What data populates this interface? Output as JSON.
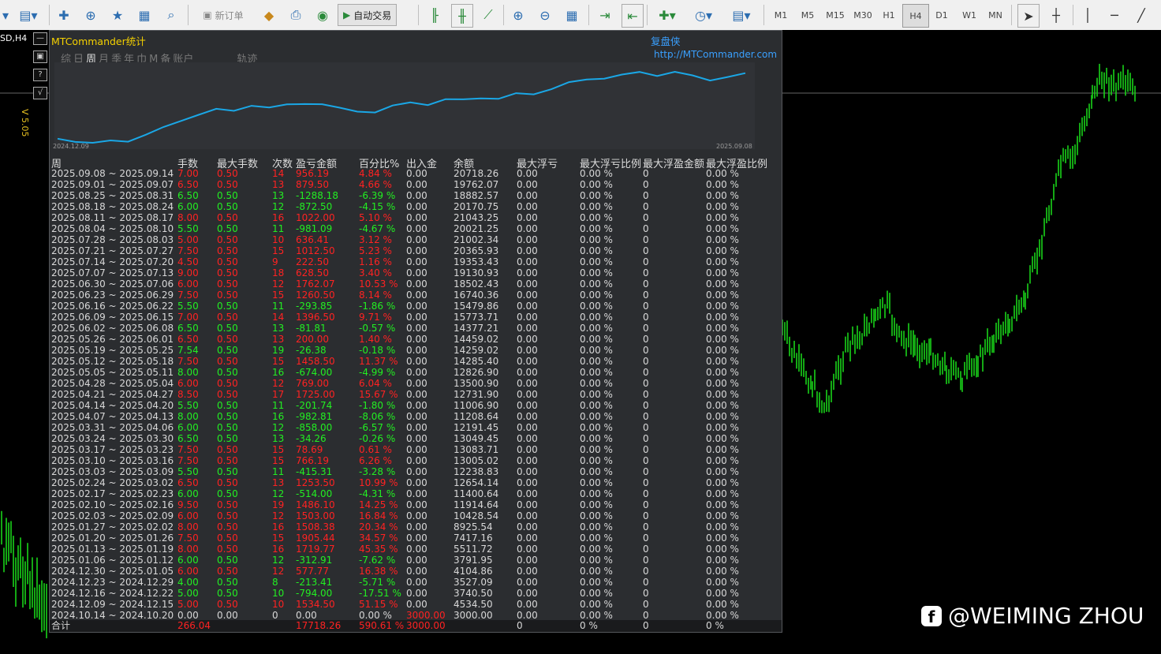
{
  "toolbar": {
    "new_order": "新订单",
    "auto_trade": "自动交易",
    "timeframes": [
      "M1",
      "M5",
      "M15",
      "M30",
      "H1",
      "H4",
      "D1",
      "W1",
      "MN"
    ],
    "selected_tf": "H4"
  },
  "chart": {
    "symbol_label": "SD,H4",
    "version": "V 5.05",
    "watermark": "@WEIMING ZHOU"
  },
  "panel": {
    "title": "MTCommander统计",
    "brand": "复盘侠",
    "url": "http://MTCommander.com",
    "tabs": [
      "综",
      "日",
      "周",
      "月",
      "季",
      "年",
      "巾",
      "M",
      "备",
      "账户",
      "轨迹"
    ],
    "active_tab": "周",
    "eq_start": "2024.12.09",
    "eq_end": "2025.09.08",
    "headers": [
      "周",
      "手数",
      "最大手数",
      "次数",
      "盈亏金额",
      "百分比%",
      "出入金",
      "余额",
      "最大浮亏",
      "最大浮亏比例",
      "最大浮盈金额",
      "最大浮盈比例"
    ],
    "rows": [
      [
        "2025.09.08 ~ 2025.09.14",
        "7.00",
        "0.50",
        "14",
        "956.19",
        "4.84 %",
        "0.00",
        "20718.26",
        "0.00",
        "0.00 %",
        "0",
        "0.00 %"
      ],
      [
        "2025.09.01 ~ 2025.09.07",
        "6.50",
        "0.50",
        "13",
        "879.50",
        "4.66 %",
        "0.00",
        "19762.07",
        "0.00",
        "0.00 %",
        "0",
        "0.00 %"
      ],
      [
        "2025.08.25 ~ 2025.08.31",
        "6.50",
        "0.50",
        "13",
        "-1288.18",
        "-6.39 %",
        "0.00",
        "18882.57",
        "0.00",
        "0.00 %",
        "0",
        "0.00 %"
      ],
      [
        "2025.08.18 ~ 2025.08.24",
        "6.00",
        "0.50",
        "12",
        "-872.50",
        "-4.15 %",
        "0.00",
        "20170.75",
        "0.00",
        "0.00 %",
        "0",
        "0.00 %"
      ],
      [
        "2025.08.11 ~ 2025.08.17",
        "8.00",
        "0.50",
        "16",
        "1022.00",
        "5.10 %",
        "0.00",
        "21043.25",
        "0.00",
        "0.00 %",
        "0",
        "0.00 %"
      ],
      [
        "2025.08.04 ~ 2025.08.10",
        "5.50",
        "0.50",
        "11",
        "-981.09",
        "-4.67 %",
        "0.00",
        "20021.25",
        "0.00",
        "0.00 %",
        "0",
        "0.00 %"
      ],
      [
        "2025.07.28 ~ 2025.08.03",
        "5.00",
        "0.50",
        "10",
        "636.41",
        "3.12 %",
        "0.00",
        "21002.34",
        "0.00",
        "0.00 %",
        "0",
        "0.00 %"
      ],
      [
        "2025.07.21 ~ 2025.07.27",
        "7.50",
        "0.50",
        "15",
        "1012.50",
        "5.23 %",
        "0.00",
        "20365.93",
        "0.00",
        "0.00 %",
        "0",
        "0.00 %"
      ],
      [
        "2025.07.14 ~ 2025.07.20",
        "4.50",
        "0.50",
        "9",
        "222.50",
        "1.16 %",
        "0.00",
        "19353.43",
        "0.00",
        "0.00 %",
        "0",
        "0.00 %"
      ],
      [
        "2025.07.07 ~ 2025.07.13",
        "9.00",
        "0.50",
        "18",
        "628.50",
        "3.40 %",
        "0.00",
        "19130.93",
        "0.00",
        "0.00 %",
        "0",
        "0.00 %"
      ],
      [
        "2025.06.30 ~ 2025.07.06",
        "6.00",
        "0.50",
        "12",
        "1762.07",
        "10.53 %",
        "0.00",
        "18502.43",
        "0.00",
        "0.00 %",
        "0",
        "0.00 %"
      ],
      [
        "2025.06.23 ~ 2025.06.29",
        "7.50",
        "0.50",
        "15",
        "1260.50",
        "8.14 %",
        "0.00",
        "16740.36",
        "0.00",
        "0.00 %",
        "0",
        "0.00 %"
      ],
      [
        "2025.06.16 ~ 2025.06.22",
        "5.50",
        "0.50",
        "11",
        "-293.85",
        "-1.86 %",
        "0.00",
        "15479.86",
        "0.00",
        "0.00 %",
        "0",
        "0.00 %"
      ],
      [
        "2025.06.09 ~ 2025.06.15",
        "7.00",
        "0.50",
        "14",
        "1396.50",
        "9.71 %",
        "0.00",
        "15773.71",
        "0.00",
        "0.00 %",
        "0",
        "0.00 %"
      ],
      [
        "2025.06.02 ~ 2025.06.08",
        "6.50",
        "0.50",
        "13",
        "-81.81",
        "-0.57 %",
        "0.00",
        "14377.21",
        "0.00",
        "0.00 %",
        "0",
        "0.00 %"
      ],
      [
        "2025.05.26 ~ 2025.06.01",
        "6.50",
        "0.50",
        "13",
        "200.00",
        "1.40 %",
        "0.00",
        "14459.02",
        "0.00",
        "0.00 %",
        "0",
        "0.00 %"
      ],
      [
        "2025.05.19 ~ 2025.05.25",
        "7.54",
        "0.50",
        "19",
        "-26.38",
        "-0.18 %",
        "0.00",
        "14259.02",
        "0.00",
        "0.00 %",
        "0",
        "0.00 %"
      ],
      [
        "2025.05.12 ~ 2025.05.18",
        "7.50",
        "0.50",
        "15",
        "1458.50",
        "11.37 %",
        "0.00",
        "14285.40",
        "0.00",
        "0.00 %",
        "0",
        "0.00 %"
      ],
      [
        "2025.05.05 ~ 2025.05.11",
        "8.00",
        "0.50",
        "16",
        "-674.00",
        "-4.99 %",
        "0.00",
        "12826.90",
        "0.00",
        "0.00 %",
        "0",
        "0.00 %"
      ],
      [
        "2025.04.28 ~ 2025.05.04",
        "6.00",
        "0.50",
        "12",
        "769.00",
        "6.04 %",
        "0.00",
        "13500.90",
        "0.00",
        "0.00 %",
        "0",
        "0.00 %"
      ],
      [
        "2025.04.21 ~ 2025.04.27",
        "8.50",
        "0.50",
        "17",
        "1725.00",
        "15.67 %",
        "0.00",
        "12731.90",
        "0.00",
        "0.00 %",
        "0",
        "0.00 %"
      ],
      [
        "2025.04.14 ~ 2025.04.20",
        "5.50",
        "0.50",
        "11",
        "-201.74",
        "-1.80 %",
        "0.00",
        "11006.90",
        "0.00",
        "0.00 %",
        "0",
        "0.00 %"
      ],
      [
        "2025.04.07 ~ 2025.04.13",
        "8.00",
        "0.50",
        "16",
        "-982.81",
        "-8.06 %",
        "0.00",
        "11208.64",
        "0.00",
        "0.00 %",
        "0",
        "0.00 %"
      ],
      [
        "2025.03.31 ~ 2025.04.06",
        "6.00",
        "0.50",
        "12",
        "-858.00",
        "-6.57 %",
        "0.00",
        "12191.45",
        "0.00",
        "0.00 %",
        "0",
        "0.00 %"
      ],
      [
        "2025.03.24 ~ 2025.03.30",
        "6.50",
        "0.50",
        "13",
        "-34.26",
        "-0.26 %",
        "0.00",
        "13049.45",
        "0.00",
        "0.00 %",
        "0",
        "0.00 %"
      ],
      [
        "2025.03.17 ~ 2025.03.23",
        "7.50",
        "0.50",
        "15",
        "78.69",
        "0.61 %",
        "0.00",
        "13083.71",
        "0.00",
        "0.00 %",
        "0",
        "0.00 %"
      ],
      [
        "2025.03.10 ~ 2025.03.16",
        "7.50",
        "0.50",
        "15",
        "766.19",
        "6.26 %",
        "0.00",
        "13005.02",
        "0.00",
        "0.00 %",
        "0",
        "0.00 %"
      ],
      [
        "2025.03.03 ~ 2025.03.09",
        "5.50",
        "0.50",
        "11",
        "-415.31",
        "-3.28 %",
        "0.00",
        "12238.83",
        "0.00",
        "0.00 %",
        "0",
        "0.00 %"
      ],
      [
        "2025.02.24 ~ 2025.03.02",
        "6.50",
        "0.50",
        "13",
        "1253.50",
        "10.99 %",
        "0.00",
        "12654.14",
        "0.00",
        "0.00 %",
        "0",
        "0.00 %"
      ],
      [
        "2025.02.17 ~ 2025.02.23",
        "6.00",
        "0.50",
        "12",
        "-514.00",
        "-4.31 %",
        "0.00",
        "11400.64",
        "0.00",
        "0.00 %",
        "0",
        "0.00 %"
      ],
      [
        "2025.02.10 ~ 2025.02.16",
        "9.50",
        "0.50",
        "19",
        "1486.10",
        "14.25 %",
        "0.00",
        "11914.64",
        "0.00",
        "0.00 %",
        "0",
        "0.00 %"
      ],
      [
        "2025.02.03 ~ 2025.02.09",
        "6.00",
        "0.50",
        "12",
        "1503.00",
        "16.84 %",
        "0.00",
        "10428.54",
        "0.00",
        "0.00 %",
        "0",
        "0.00 %"
      ],
      [
        "2025.01.27 ~ 2025.02.02",
        "8.00",
        "0.50",
        "16",
        "1508.38",
        "20.34 %",
        "0.00",
        "8925.54",
        "0.00",
        "0.00 %",
        "0",
        "0.00 %"
      ],
      [
        "2025.01.20 ~ 2025.01.26",
        "7.50",
        "0.50",
        "15",
        "1905.44",
        "34.57 %",
        "0.00",
        "7417.16",
        "0.00",
        "0.00 %",
        "0",
        "0.00 %"
      ],
      [
        "2025.01.13 ~ 2025.01.19",
        "8.00",
        "0.50",
        "16",
        "1719.77",
        "45.35 %",
        "0.00",
        "5511.72",
        "0.00",
        "0.00 %",
        "0",
        "0.00 %"
      ],
      [
        "2025.01.06 ~ 2025.01.12",
        "6.00",
        "0.50",
        "12",
        "-312.91",
        "-7.62 %",
        "0.00",
        "3791.95",
        "0.00",
        "0.00 %",
        "0",
        "0.00 %"
      ],
      [
        "2024.12.30 ~ 2025.01.05",
        "6.00",
        "0.50",
        "12",
        "577.77",
        "16.38 %",
        "0.00",
        "4104.86",
        "0.00",
        "0.00 %",
        "0",
        "0.00 %"
      ],
      [
        "2024.12.23 ~ 2024.12.29",
        "4.00",
        "0.50",
        "8",
        "-213.41",
        "-5.71 %",
        "0.00",
        "3527.09",
        "0.00",
        "0.00 %",
        "0",
        "0.00 %"
      ],
      [
        "2024.12.16 ~ 2024.12.22",
        "5.00",
        "0.50",
        "10",
        "-794.00",
        "-17.51 %",
        "0.00",
        "3740.50",
        "0.00",
        "0.00 %",
        "0",
        "0.00 %"
      ],
      [
        "2024.12.09 ~ 2024.12.15",
        "5.00",
        "0.50",
        "10",
        "1534.50",
        "51.15 %",
        "0.00",
        "4534.50",
        "0.00",
        "0.00 %",
        "0",
        "0.00 %"
      ],
      [
        "2024.10.14 ~ 2024.10.20",
        "0.00",
        "0.00",
        "0",
        "0.00",
        "0.00 %",
        "3000.00",
        "3000.00",
        "0.00",
        "0.00 %",
        "0",
        "0.00 %"
      ]
    ],
    "total": [
      "合计",
      "266.04",
      "",
      "",
      "17718.26",
      "590.61 %",
      "3000.00",
      "",
      "0",
      "0 %",
      "0",
      "0 %"
    ],
    "colors": {
      "profit": "#ff2222",
      "loss": "#22ee22",
      "neutral": "#d8d8d8",
      "equity": "#1aa7e6"
    }
  }
}
